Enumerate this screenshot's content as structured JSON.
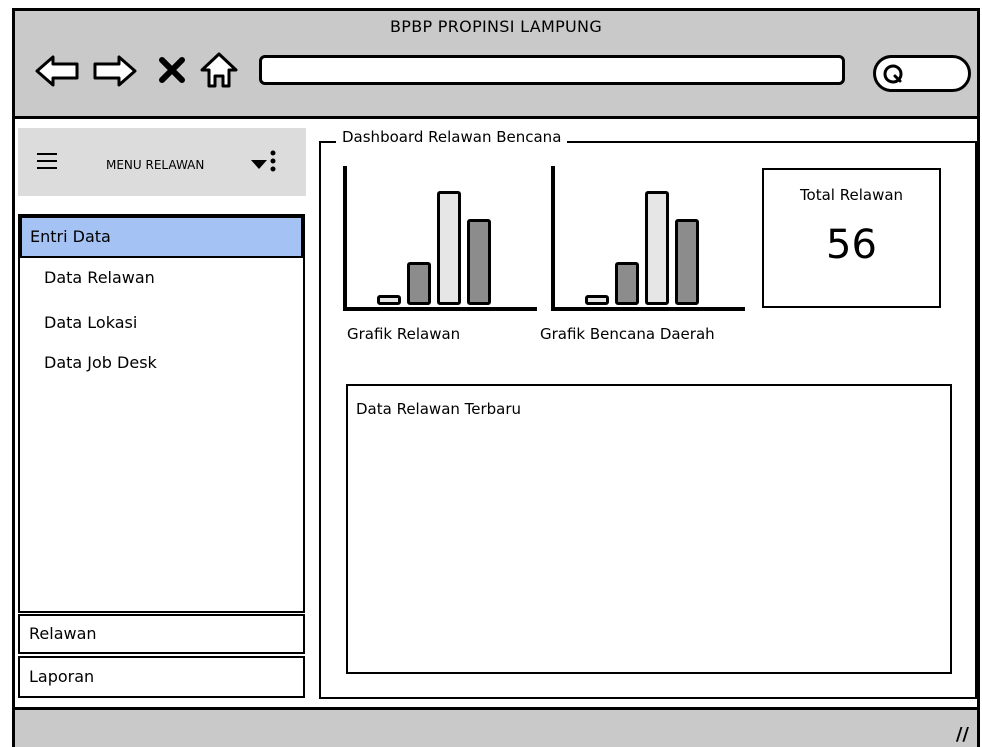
{
  "browser": {
    "title": "BPBP PROPINSI LAMPUNG",
    "url_value": ""
  },
  "sidebar": {
    "menu_title": "MENU RELAWAN",
    "active_section": "Entri Data",
    "items": [
      {
        "label": "Data Relawan"
      },
      {
        "label": "Data Lokasi"
      },
      {
        "label": "Data Job Desk"
      }
    ],
    "sections": [
      {
        "label": "Relawan"
      },
      {
        "label": "Laporan"
      }
    ]
  },
  "dashboard": {
    "title": "Dashboard Relawan Bencana",
    "charts": [
      {
        "label": "Grafik Relawan"
      },
      {
        "label": "Grafik Bencana Daerah"
      }
    ],
    "total": {
      "label": "Total Relawan",
      "value": "56"
    },
    "recent": {
      "title": "Data Relawan Terbaru"
    }
  },
  "chart_data": [
    {
      "type": "bar",
      "title": "Grafik Relawan",
      "values": [
        1,
        4,
        9,
        7
      ],
      "colors": [
        "#e6e6e6",
        "#8c8c8c",
        "#e6e6e6",
        "#8c8c8c"
      ]
    },
    {
      "type": "bar",
      "title": "Grafik Bencana Daerah",
      "values": [
        1,
        4,
        9,
        7
      ],
      "colors": [
        "#e6e6e6",
        "#8c8c8c",
        "#e6e6e6",
        "#8c8c8c"
      ]
    }
  ],
  "icons": [
    "back-arrow-icon",
    "forward-arrow-icon",
    "close-icon",
    "home-icon",
    "search-icon",
    "hamburger-icon",
    "dropdown-arrow-icon",
    "more-options-icon",
    "resize-handle-icon"
  ]
}
